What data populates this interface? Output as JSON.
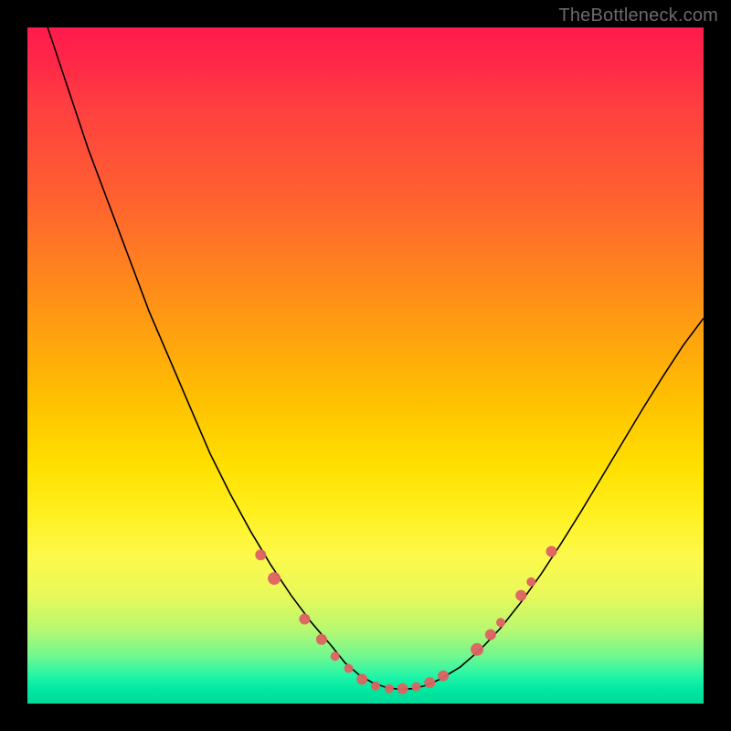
{
  "watermark": "TheBottleneck.com",
  "chart_data": {
    "type": "line",
    "title": "",
    "xlabel": "",
    "ylabel": "",
    "xlim": [
      0,
      100
    ],
    "ylim": [
      0,
      100
    ],
    "grid": false,
    "legend": false,
    "background": "rainbow-gradient-vertical",
    "series": [
      {
        "name": "bottleneck-curve",
        "color": "#000000",
        "x": [
          0,
          3,
          6,
          9,
          12,
          15,
          18,
          21,
          24,
          27,
          30,
          33,
          36,
          39,
          42,
          45,
          47,
          49,
          51,
          53,
          55,
          57,
          59,
          61,
          64,
          67,
          70,
          73,
          76,
          79,
          82,
          85,
          88,
          91,
          94,
          97,
          100
        ],
        "y": [
          120,
          100,
          91,
          82,
          74,
          66,
          58,
          51,
          44,
          37,
          31,
          25.5,
          20.5,
          16,
          12,
          8.5,
          6,
          4.3,
          3.1,
          2.4,
          2.1,
          2.2,
          2.7,
          3.6,
          5.4,
          8,
          11.2,
          15,
          19.2,
          23.8,
          28.6,
          33.6,
          38.6,
          43.6,
          48.4,
          53,
          57
        ]
      }
    ],
    "scatter_points": {
      "name": "highlighted-points",
      "color": "#de6262",
      "points": [
        {
          "x": 34.5,
          "y": 22,
          "r": 6
        },
        {
          "x": 36.5,
          "y": 18.5,
          "r": 7
        },
        {
          "x": 41,
          "y": 12.5,
          "r": 6
        },
        {
          "x": 43.5,
          "y": 9.5,
          "r": 6
        },
        {
          "x": 45.5,
          "y": 7,
          "r": 5
        },
        {
          "x": 47.5,
          "y": 5.2,
          "r": 5
        },
        {
          "x": 49.5,
          "y": 3.6,
          "r": 6
        },
        {
          "x": 51.5,
          "y": 2.6,
          "r": 5
        },
        {
          "x": 53.5,
          "y": 2.2,
          "r": 5
        },
        {
          "x": 55.5,
          "y": 2.2,
          "r": 6
        },
        {
          "x": 57.5,
          "y": 2.5,
          "r": 5
        },
        {
          "x": 59.5,
          "y": 3.1,
          "r": 6
        },
        {
          "x": 61.5,
          "y": 4.1,
          "r": 6
        },
        {
          "x": 66.5,
          "y": 8,
          "r": 7
        },
        {
          "x": 68.5,
          "y": 10.2,
          "r": 6
        },
        {
          "x": 70,
          "y": 12,
          "r": 5
        },
        {
          "x": 73,
          "y": 16,
          "r": 6
        },
        {
          "x": 74.5,
          "y": 18,
          "r": 5
        },
        {
          "x": 77.5,
          "y": 22.5,
          "r": 6
        }
      ]
    }
  }
}
